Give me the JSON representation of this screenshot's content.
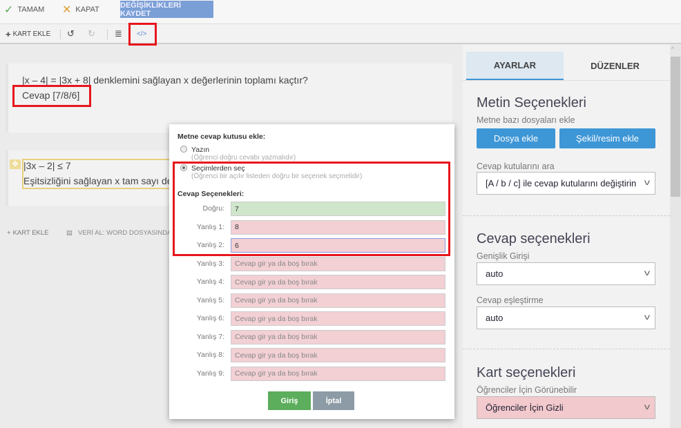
{
  "topbar": {
    "ok_label": "TAMAM",
    "close_label": "KAPAT",
    "save_label": "DEĞİŞİKLİKLERİ KAYDET"
  },
  "toolbar": {
    "add_card_label": "KART EKLE"
  },
  "cards": [
    {
      "question": "|x – 4| = |3x + 8| denklemini sağlayan x değerlerinin toplamı kaçtır?",
      "answer": "Cevap [7/8/6]"
    },
    {
      "question": "|3x – 2| ≤ 7",
      "line2": "Eşitsizliğini sağlayan x tam sayı değe"
    }
  ],
  "bottom": {
    "add_card_label": "KART EKLE",
    "import_label": "VERİ AL: WORD DOSYASINDA"
  },
  "modal": {
    "title": "Metne cevap kutusu ekle:",
    "option_type": {
      "label": "Yazın",
      "hint": "(Öğrenci doğru cevabı yazmalıdır)"
    },
    "option_select": {
      "label": "Seçimlerden seç",
      "hint": "(Öğrenci bir açılır listeden doğru bir seçenek seçmelidir)"
    },
    "choices_title": "Cevap Seçenekleri:",
    "rows": [
      {
        "label": "Doğru:",
        "value": "7"
      },
      {
        "label": "Yanlış 1:",
        "value": "8"
      },
      {
        "label": "Yanlış 2:",
        "value": "6"
      },
      {
        "label": "Yanlış 3:",
        "placeholder": "Cevap gir ya da boş bırak"
      },
      {
        "label": "Yanlış 4:",
        "placeholder": "Cevap gir ya da boş bırak"
      },
      {
        "label": "Yanlış 5:",
        "placeholder": "Cevap gir ya da boş bırak"
      },
      {
        "label": "Yanlış 6:",
        "placeholder": "Cevap gir ya da boş bırak"
      },
      {
        "label": "Yanlış 7:",
        "placeholder": "Cevap gir ya da boş bırak"
      },
      {
        "label": "Yanlış 8:",
        "placeholder": "Cevap gir ya da boş bırak"
      },
      {
        "label": "Yanlış 9:",
        "placeholder": "Cevap gir ya da boş bırak"
      }
    ],
    "submit_label": "Giriş",
    "cancel_label": "İptal"
  },
  "panel": {
    "tabs": [
      "AYARLAR",
      "DÜZENLER"
    ],
    "text_options": {
      "title": "Metin Seçenekleri",
      "files_label": "Metne bazı dosyaları ekle",
      "add_file": "Dosya ekle",
      "add_image": "Şekil/resim ekle",
      "search_label": "Cevap kutularını ara",
      "search_value": "[A / b / c] ile cevap kutularını değiştirin"
    },
    "answer_options": {
      "title": "Cevap seçenekleri",
      "width_label": "Genişlik Girişi",
      "width_value": "auto",
      "match_label": "Cevap eşleştirme",
      "match_value": "auto"
    },
    "card_options": {
      "title": "Kart seçenekleri",
      "visible_label": "Öğrenciler İçin Görünebilir",
      "visible_value": "Öğrenciler İçin Gizli"
    }
  },
  "colors": {
    "accent": "#3d96d6",
    "correct": "#d0e6cc",
    "wrong": "#f2d0d4",
    "highlight": "#e8141c"
  }
}
